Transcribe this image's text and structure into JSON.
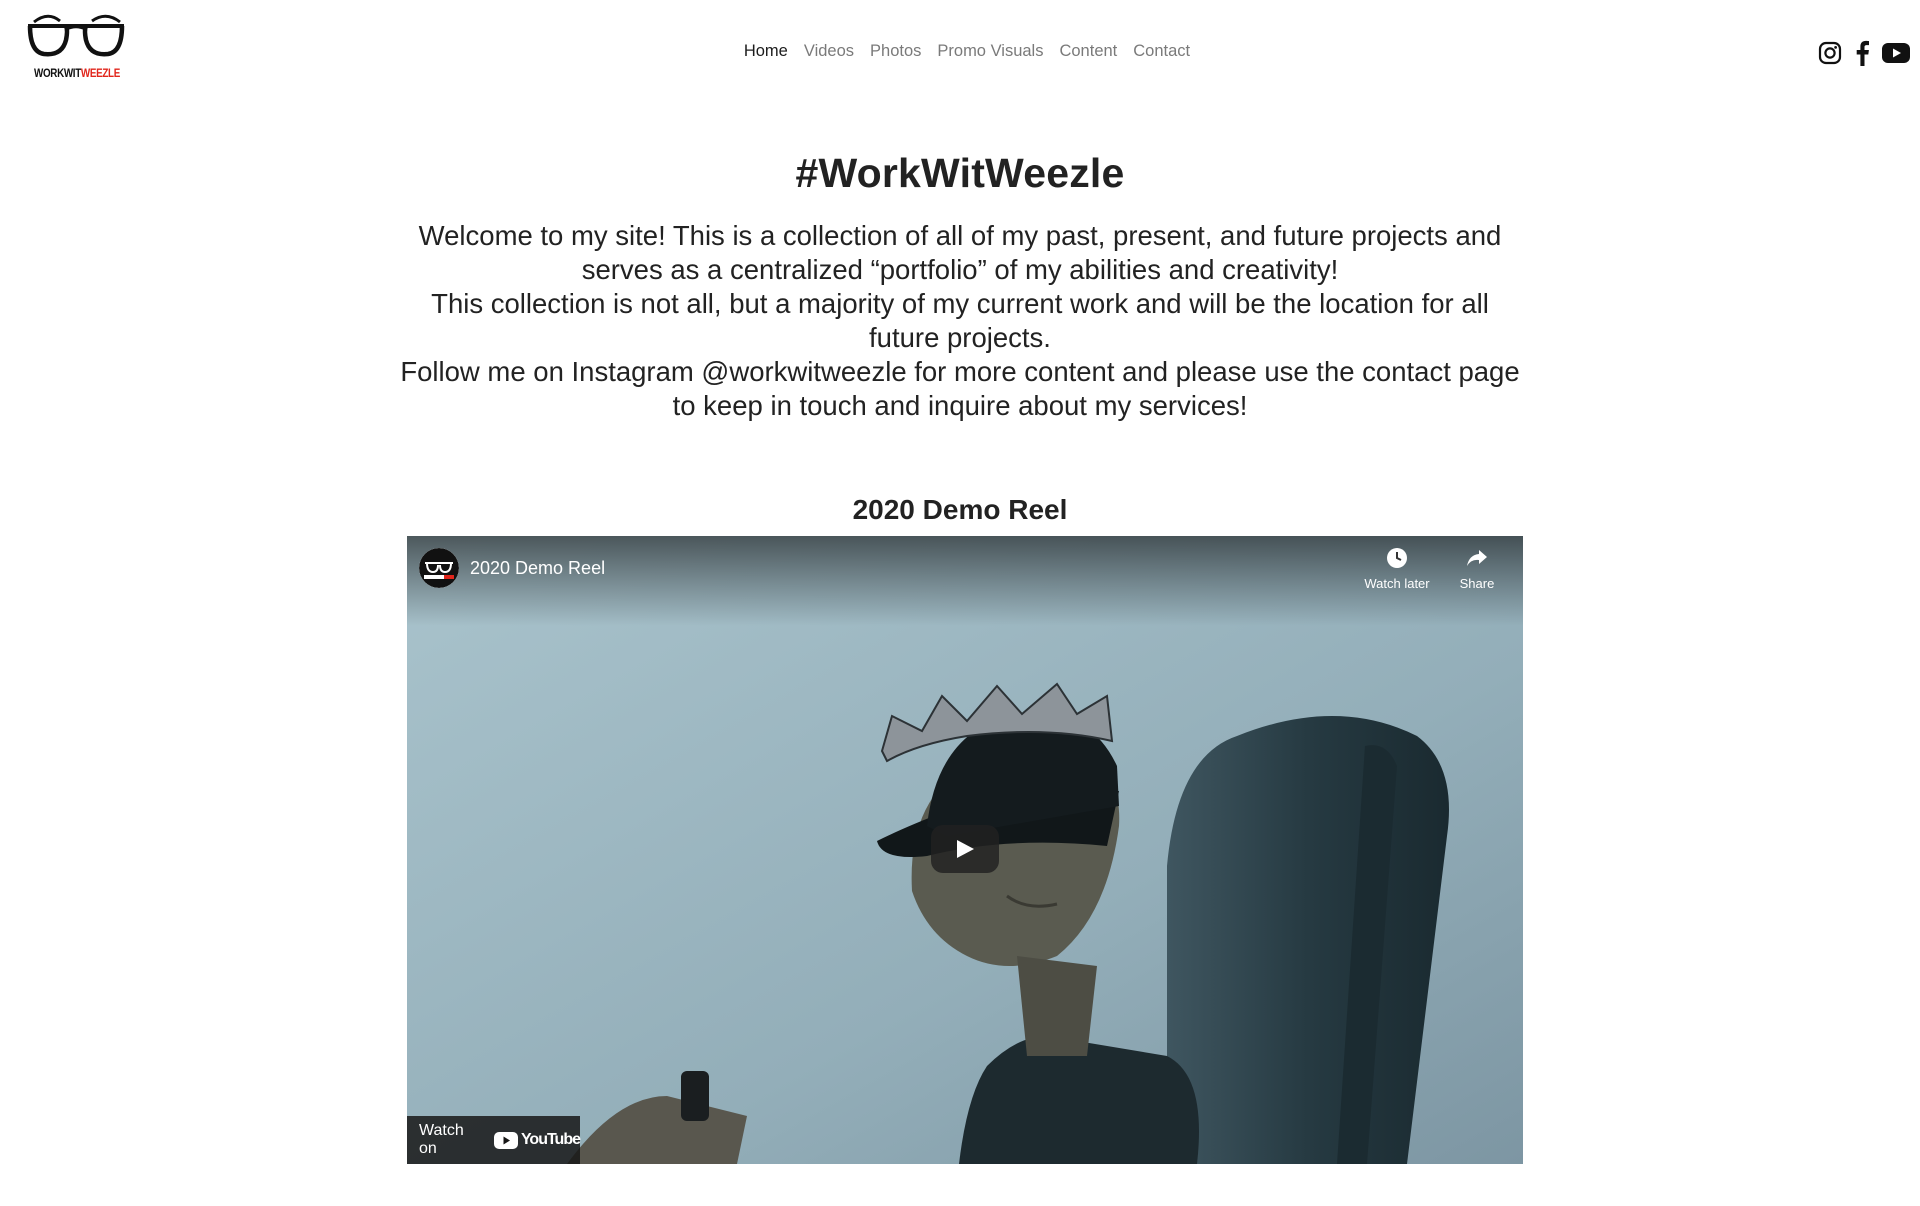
{
  "brand": {
    "logo_icon": "glasses-logo",
    "logo_text_part1": "WORKWIT",
    "logo_text_part2": "WEEZLE",
    "logo_accent_color": "#e1251b"
  },
  "nav": {
    "items": [
      {
        "label": "Home",
        "active": true
      },
      {
        "label": "Videos",
        "active": false
      },
      {
        "label": "Photos",
        "active": false
      },
      {
        "label": "Promo Visuals",
        "active": false
      },
      {
        "label": "Content",
        "active": false
      },
      {
        "label": "Contact",
        "active": false
      }
    ]
  },
  "social": {
    "icons": [
      "instagram-icon",
      "facebook-icon",
      "youtube-icon"
    ]
  },
  "main": {
    "title": "#WorkWitWeezle",
    "intro": [
      "Welcome to my site! This is a collection of all of my past, present, and future projects and serves as a centralized “portfolio” of my abilities and creativity!",
      "This collection is not all, but a majority of my current work and will be the location for all future projects.",
      "Follow me on Instagram @workwitweezle for more content and please use the contact page to keep in touch and inquire about my services!"
    ],
    "reel_heading": "2020 Demo Reel"
  },
  "video": {
    "title": "2020 Demo Reel",
    "watch_later_label": "Watch later",
    "share_label": "Share",
    "watch_on_label": "Watch on",
    "platform_label": "YouTube"
  }
}
